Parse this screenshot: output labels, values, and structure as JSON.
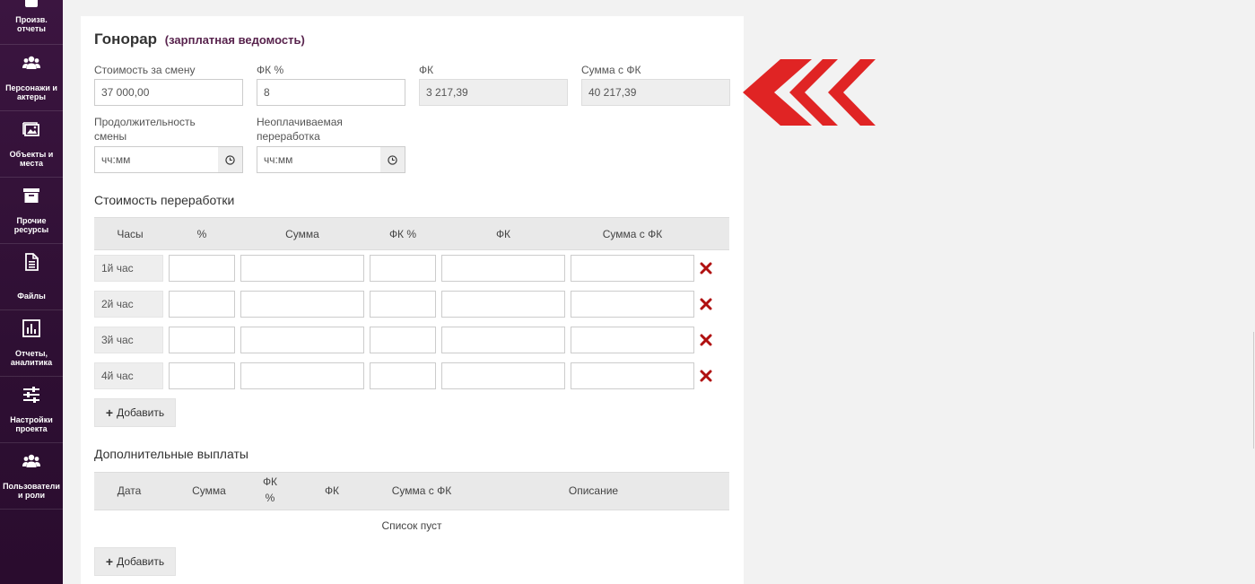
{
  "sidebar": {
    "items": [
      {
        "label": "Произв. отчеты",
        "icon": "report-icon"
      },
      {
        "label": "Персонажи и актеры",
        "icon": "users-icon"
      },
      {
        "label": "Объекты и места",
        "icon": "image-icon"
      },
      {
        "label": "Прочие ресурсы",
        "icon": "archive-icon"
      },
      {
        "label": "Файлы",
        "icon": "file-icon"
      },
      {
        "label": "Отчеты, аналитика",
        "icon": "bar-chart-icon"
      },
      {
        "label": "Настройки проекта",
        "icon": "sliders-icon"
      },
      {
        "label": "Пользователи и роли",
        "icon": "users-icon"
      }
    ]
  },
  "page": {
    "title": "Гонорар",
    "subtitle": "(зарплатная ведомость)"
  },
  "fee": {
    "shift_cost_label": "Стоимость за смену",
    "shift_cost_value": "37 000,00",
    "fk_pct_label": "ФК %",
    "fk_pct_value": "8",
    "fk_label": "ФК",
    "fk_value": "3 217,39",
    "total_label": "Сумма с ФК",
    "total_value": "40 217,39",
    "duration_label_1": "Продолжительность",
    "duration_label_2": "смены",
    "duration_placeholder": "чч:мм",
    "unpaid_label_1": "Неоплачиваемая",
    "unpaid_label_2": "переработка",
    "unpaid_placeholder": "чч:мм"
  },
  "overtime": {
    "title": "Стоимость переработки",
    "columns": [
      "Часы",
      "%",
      "Сумма",
      "ФК %",
      "ФК",
      "Сумма с ФК"
    ],
    "rows": [
      {
        "hour": "1й час"
      },
      {
        "hour": "2й час"
      },
      {
        "hour": "3й час"
      },
      {
        "hour": "4й час"
      }
    ],
    "add_label": "Добавить"
  },
  "extra": {
    "title": "Дополнительные выплаты",
    "columns": {
      "date": "Дата",
      "sum": "Сумма",
      "fk_pct_1": "ФК",
      "fk_pct_2": "%",
      "fk": "ФК",
      "total": "Сумма с ФК",
      "desc": "Описание"
    },
    "empty_text": "Список пуст",
    "add_label": "Добавить"
  },
  "colors": {
    "sidebar_bg": "#3b1540",
    "accent_arrow": "#e02424",
    "delete_icon": "#b01010",
    "subtitle": "#58234d"
  }
}
